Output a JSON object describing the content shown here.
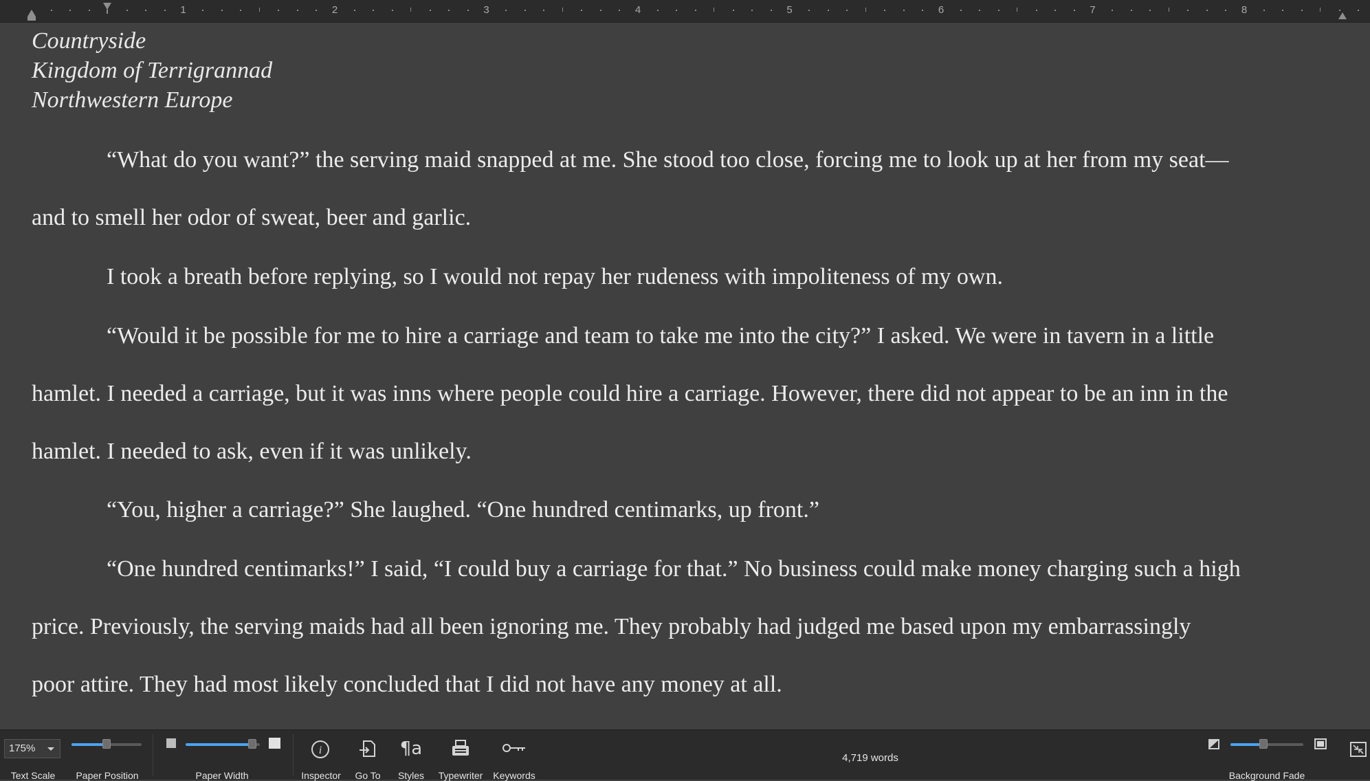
{
  "ruler": {
    "numbers": [
      "1",
      "2",
      "3",
      "4",
      "5",
      "6",
      "7",
      "8"
    ]
  },
  "document": {
    "header": [
      "Countryside",
      "Kingdom of Terrigrannad",
      "Northwestern Europe"
    ],
    "lines": [
      "“What do you want?” the serving maid snapped at me. She stood too close, forcing me to look up at her from my seat—",
      "and to smell her odor of sweat, beer and garlic.",
      "I took a breath before replying, so I would not repay her rudeness with impoliteness of my own.",
      "“Would it be possible for me to hire a carriage and team to take me into the city?”  I asked.  We were in tavern in a little",
      "hamlet.  I needed a carriage, but it was inns where people could hire a carriage.  However, there did not appear to be an inn in the",
      "hamlet.  I needed to ask, even if it was unlikely.",
      "“You, higher a carriage?”  She laughed.  “One hundred centimarks, up front.”",
      "“One hundred centimarks!” I said, “I could buy a carriage for that.”  No business could make money charging such a high",
      "price.  Previously, the serving maids had all been ignoring me.  They probably had judged me based upon my embarrassingly",
      "poor attire.  They had most likely concluded that I did not have any money at all."
    ]
  },
  "statusbar": {
    "zoom_value": "175%",
    "text_scale_label": "Text Scale",
    "paper_position_label": "Paper Position",
    "paper_width_label": "Paper Width",
    "inspector_label": "Inspector",
    "goto_label": "Go To",
    "styles_label": "Styles",
    "typewriter_label": "Typewriter",
    "keywords_label": "Keywords",
    "word_count": "4,719 words",
    "background_fade_label": "Background Fade",
    "paper_position_level": 0.5,
    "paper_width_level": 0.9,
    "background_fade_level": 0.45
  },
  "colors": {
    "editor_background": "#404040",
    "text": "#ececec",
    "bar_background": "#2b2b2b",
    "slider_accent": "#4aa3f2"
  }
}
